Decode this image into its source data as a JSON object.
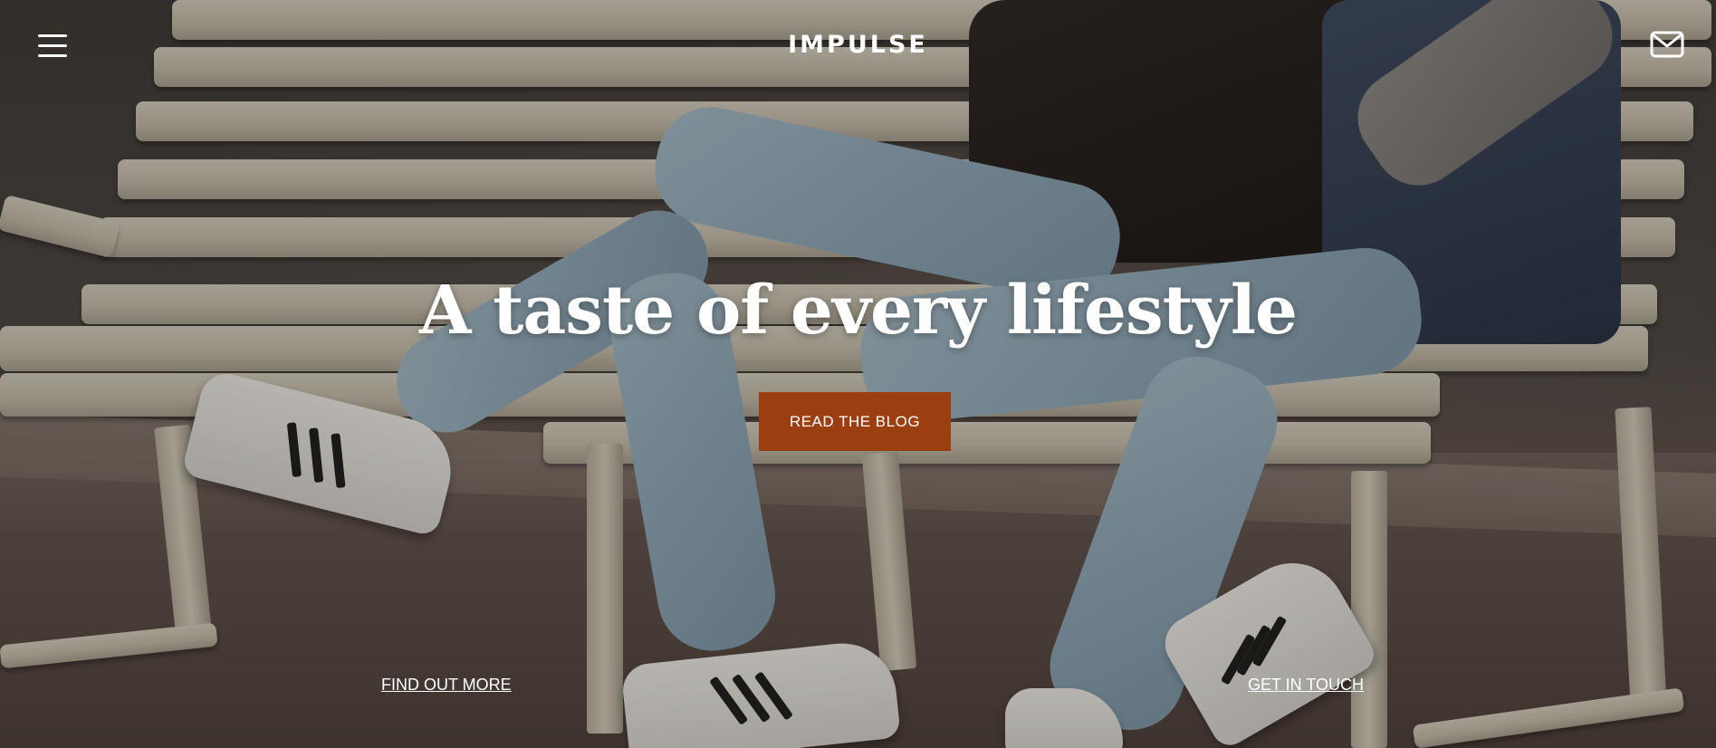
{
  "header": {
    "brand": "IMPULSE",
    "menu_icon": "hamburger-menu-icon",
    "mail_icon": "envelope-icon"
  },
  "hero": {
    "headline": "A taste of every lifestyle",
    "cta_label": "READ THE BLOG",
    "cta_color": "#9b3f11"
  },
  "footer_links": {
    "left": "FIND OUT MORE",
    "right": "GET IN TOUCH"
  }
}
